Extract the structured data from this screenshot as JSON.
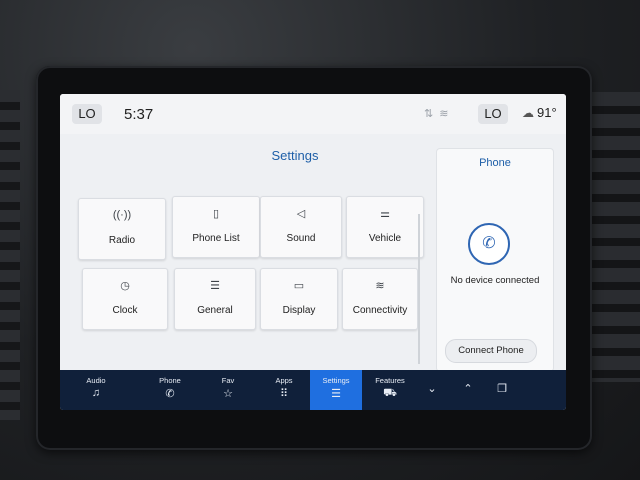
{
  "status_bar": {
    "left_chip": "LO",
    "time": "5:37",
    "icons": [
      "no-signal-icon",
      "wifi-icon"
    ],
    "right_chip": "LO",
    "temperature": "91°",
    "weather_icon": "partly-cloudy-icon"
  },
  "settings": {
    "title": "Settings",
    "tiles": [
      {
        "label": "Radio",
        "icon": "radio-antenna-icon"
      },
      {
        "label": "Phone List",
        "icon": "phone-list-icon"
      },
      {
        "label": "Sound",
        "icon": "speaker-icon"
      },
      {
        "label": "Vehicle",
        "icon": "vehicle-icon"
      },
      {
        "label": "Clock",
        "icon": "clock-icon"
      },
      {
        "label": "General",
        "icon": "sliders-icon"
      },
      {
        "label": "Display",
        "icon": "display-icon"
      },
      {
        "label": "Connectivity",
        "icon": "wifi-icon"
      }
    ]
  },
  "phone": {
    "title": "Phone",
    "message": "No device connected",
    "connect_label": "Connect Phone"
  },
  "nav": {
    "items": [
      {
        "label": "Audio",
        "icon": "music-note-icon"
      },
      {
        "label": "Phone",
        "icon": "phone-icon"
      },
      {
        "label": "Fav",
        "icon": "star-icon"
      },
      {
        "label": "Apps",
        "icon": "apps-grid-icon"
      },
      {
        "label": "Settings",
        "icon": "sliders-icon",
        "active": true
      },
      {
        "label": "Features",
        "icon": "car-features-icon"
      }
    ],
    "extra": [
      "chevron-down-icon",
      "chevron-up-icon",
      "window-icon"
    ]
  },
  "colors": {
    "accent": "#1e5fa8",
    "nav_bg": "#10203a",
    "nav_active": "#1f6fe0"
  }
}
